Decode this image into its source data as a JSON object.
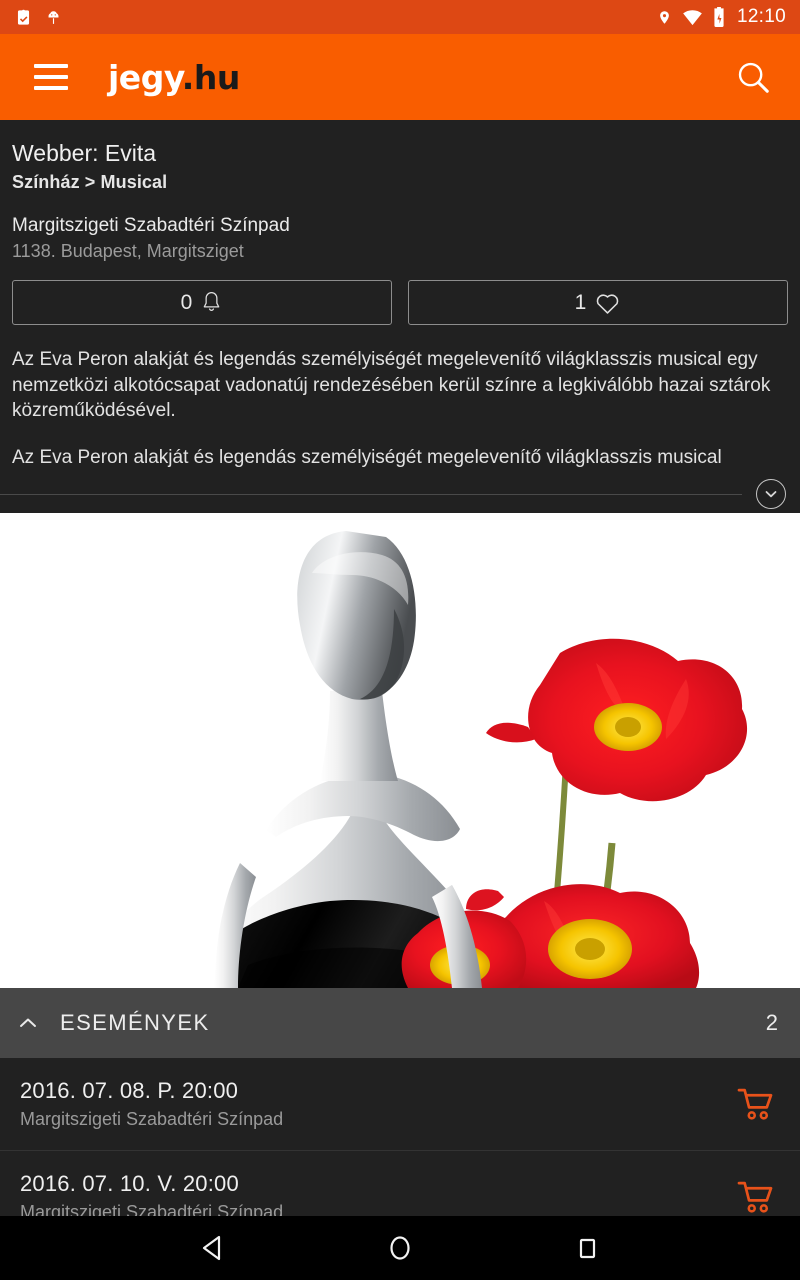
{
  "status_bar": {
    "time": "12:10",
    "left_icons": [
      "clipboard-check-icon",
      "android-debug-icon"
    ],
    "right_icons": [
      "location-pin-icon",
      "wifi-icon",
      "battery-charging-icon"
    ],
    "background_color": "#dd4814"
  },
  "app_bar": {
    "menu_icon": "hamburger-menu-icon",
    "brand_name": "jegy",
    "brand_tld": ".hu",
    "search_icon": "search-icon",
    "background_color": "#f95d00"
  },
  "detail": {
    "title": "Webber: Evita",
    "breadcrumb": "Színház > Musical",
    "venue_name": "Margitszigeti Szabadtéri Színpad",
    "venue_address": "1138. Budapest, Margitsziget",
    "actions": [
      {
        "count": "0",
        "icon": "bell-icon",
        "name": "notify-button"
      },
      {
        "count": "1",
        "icon": "heart-icon",
        "name": "favorite-button"
      }
    ],
    "description_paragraphs": [
      "Az Eva Peron alakját és legendás személyiségét megelevenítő világklasszis musical egy nemzetközi alkotócsapat vadonatúj rendezésében kerül színre a legkiválóbb hazai sztárok közreműködésével.",
      "Az Eva Peron alakját és legendás személyiségét megelevenítő világklasszis musical"
    ],
    "expand_icon": "chevron-down-circle-icon"
  },
  "poster": {
    "alt": "Evita poster — black and white woman from behind with red poppies",
    "background_color": "#ffffff",
    "accent_color": "#e8192c"
  },
  "events_section": {
    "collapse_icon": "chevron-up-icon",
    "title": "ESEMÉNYEK",
    "count": "2",
    "background_color": "#474747",
    "rows": [
      {
        "date": "2016. 07. 08. P. 20:00",
        "venue": "Margitszigeti Szabadtéri Színpad",
        "cart_icon": "shopping-cart-icon"
      },
      {
        "date": "2016. 07. 10. V. 20:00",
        "venue": "Margitszigeti Szabadtéri Színpad",
        "cart_icon": "shopping-cart-icon"
      }
    ]
  },
  "nav_bar": {
    "buttons": [
      {
        "name": "nav-back-button",
        "icon": "triangle-back-icon"
      },
      {
        "name": "nav-home-button",
        "icon": "circle-home-icon"
      },
      {
        "name": "nav-recents-button",
        "icon": "square-recents-icon"
      }
    ]
  },
  "colors": {
    "accent_orange": "#f95d00",
    "status_orange": "#dd4814",
    "surface_dark": "#212121",
    "section_gray": "#474747",
    "cart_orange": "#e8521a"
  }
}
